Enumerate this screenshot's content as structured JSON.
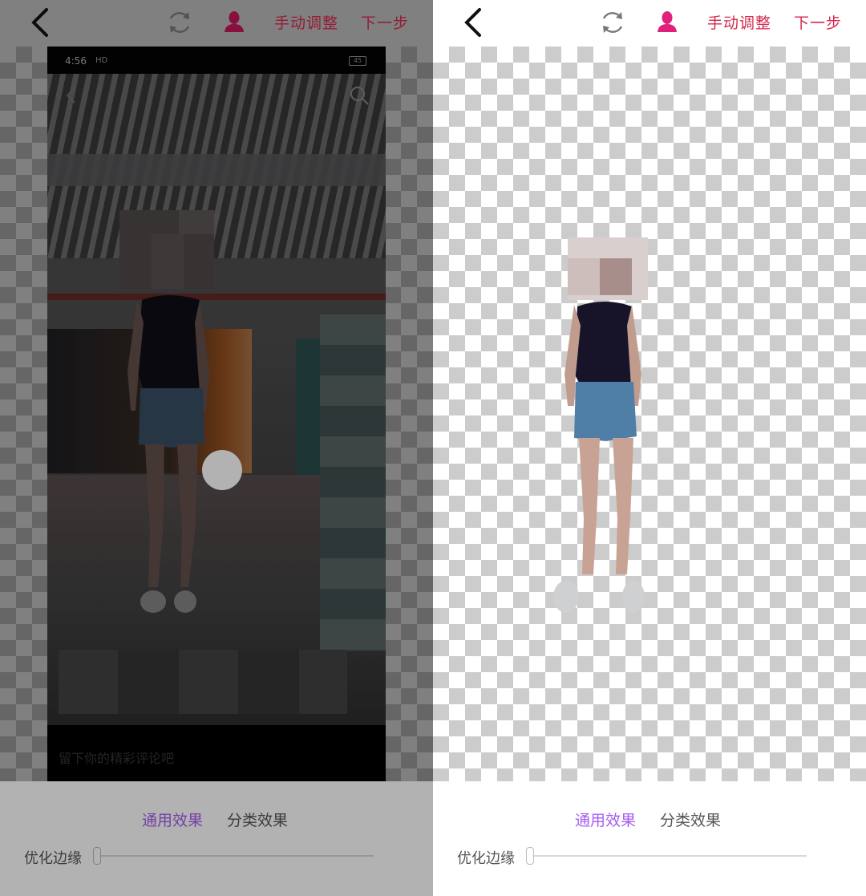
{
  "top_bar": {
    "manual_label": "手动调整",
    "next_label": "下一步"
  },
  "bottom": {
    "tab_general": "通用效果",
    "tab_category": "分类效果",
    "slider_label": "优化边缘",
    "slider_value": 0
  },
  "embedded_phone": {
    "status_time": "4:56",
    "status_signal": "HD",
    "battery": "45",
    "comment_placeholder": "留下你的精彩评论吧"
  },
  "colors": {
    "accent_red": "#d42a4e",
    "person_icon": "#c2185b",
    "tab_active": "#a55cf0"
  }
}
